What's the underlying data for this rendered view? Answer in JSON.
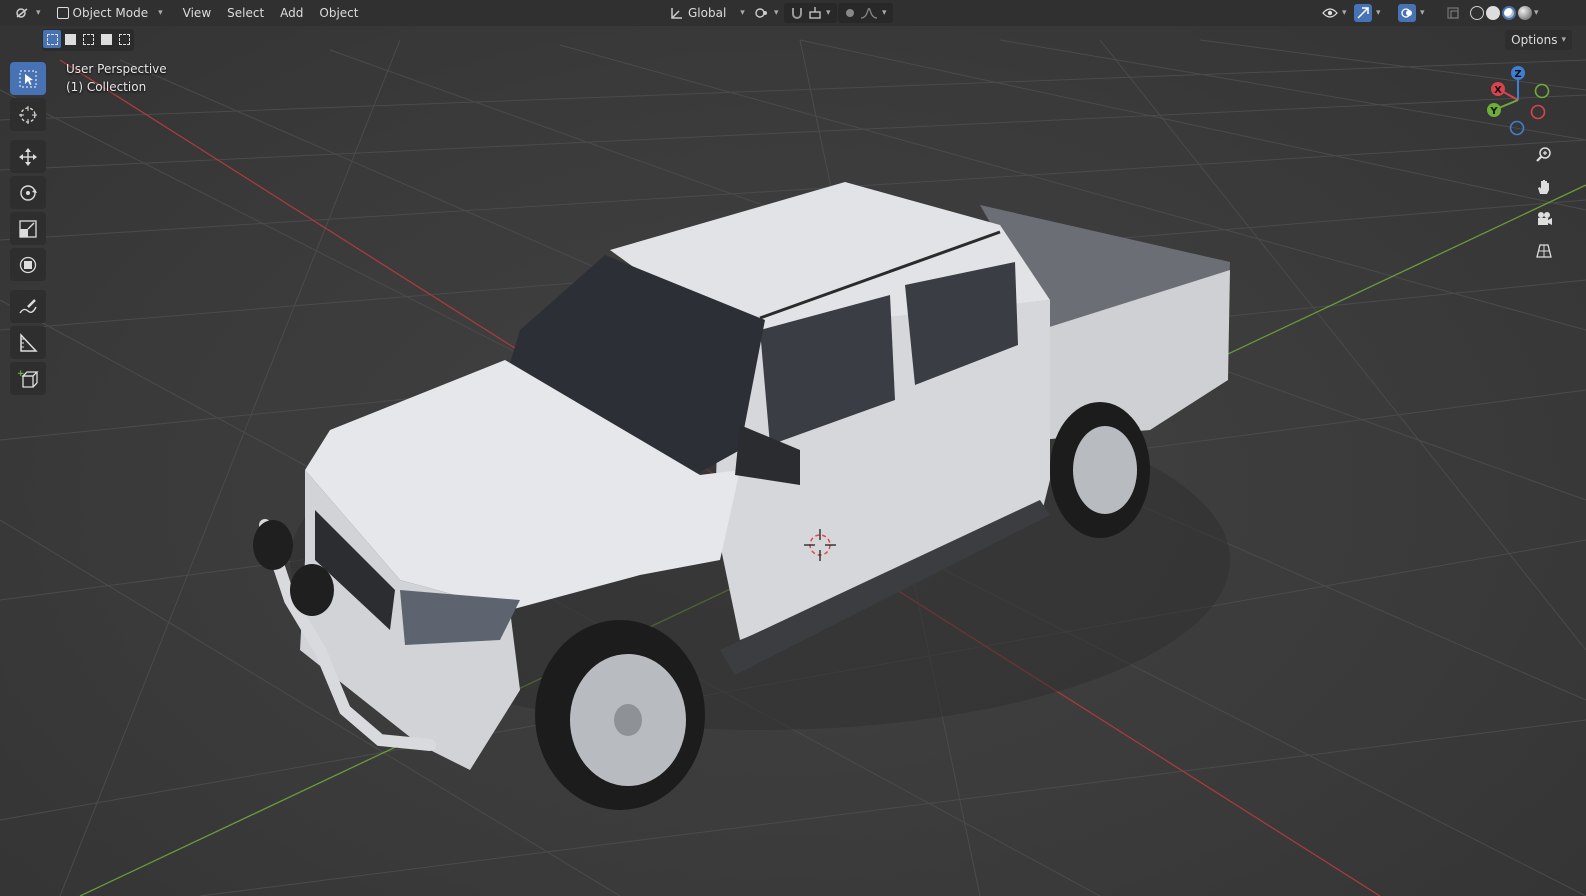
{
  "header": {
    "editor_type_icon": "editor-type-icon",
    "mode": "Object Mode",
    "menus": [
      "View",
      "Select",
      "Add",
      "Object"
    ],
    "transform_orientation": "Global"
  },
  "options_label": "Options",
  "overlay": {
    "view_name": "User Perspective",
    "collection": "(1) Collection"
  },
  "gizmo": {
    "axes": {
      "x": "X",
      "y": "Y",
      "z": "Z"
    },
    "colors": {
      "x": "#d8434f",
      "y": "#6fad3b",
      "z": "#3e7fd3"
    }
  },
  "tools": [
    "select-box-icon",
    "cursor-icon",
    "move-icon",
    "rotate-icon",
    "scale-icon",
    "transform-icon",
    "annotate-icon",
    "measure-icon",
    "add-cube-icon"
  ],
  "nav_buttons": [
    "zoom-icon",
    "pan-hand-icon",
    "camera-icon",
    "grid-view-icon"
  ],
  "colors": {
    "accent": "#4772b3",
    "x_axis_line": "#a83a3f",
    "y_axis_line": "#6a9a3a",
    "grid": "#4a4a4a"
  }
}
